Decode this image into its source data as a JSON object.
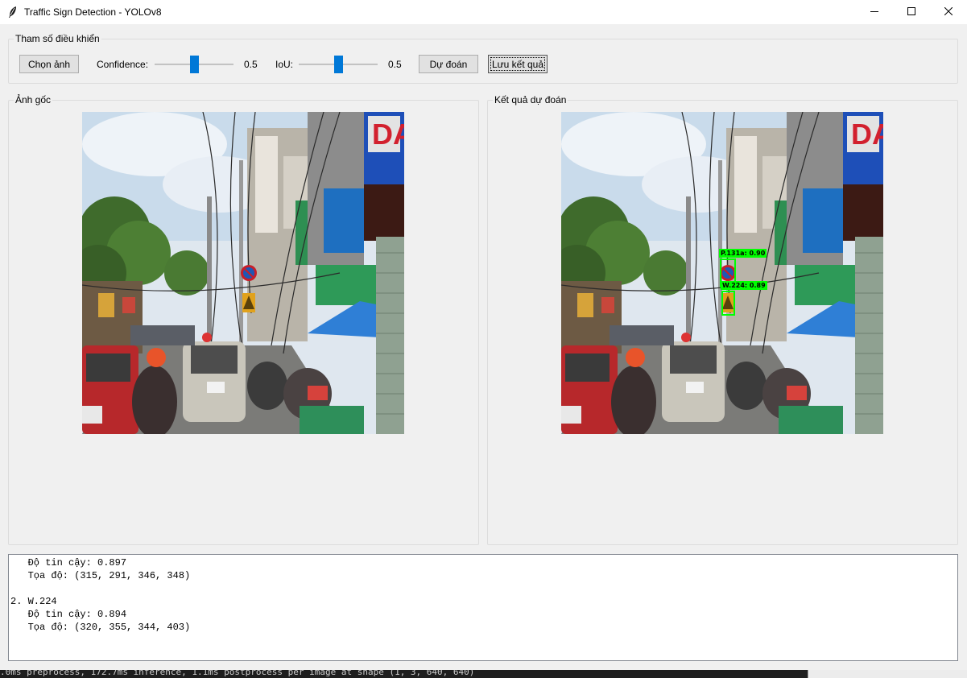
{
  "window": {
    "title": "Traffic Sign Detection - YOLOv8"
  },
  "controls": {
    "group_label": "Tham số điều khiển",
    "choose_image": "Chọn ảnh",
    "confidence_label": "Confidence:",
    "confidence_value": "0.5",
    "confidence_level": 0.5,
    "iou_label": "IoU:",
    "iou_value": "0.5",
    "iou_level": 0.5,
    "predict": "Dự đoán",
    "save_result": "Lưu kết quả"
  },
  "original": {
    "group_label": "Ảnh gốc"
  },
  "result": {
    "group_label": "Kết quả dự đoán",
    "detections": [
      {
        "label": "P.131a: 0.90"
      },
      {
        "label": "W.224: 0.89"
      }
    ]
  },
  "output": {
    "lines": [
      "   Độ tin cậy: 0.897",
      "   Tọa độ: (315, 291, 346, 348)",
      "",
      "2. W.224",
      "   Độ tin cậy: 0.894",
      "   Tọa độ: (320, 355, 344, 403)"
    ]
  },
  "console": {
    "text": ".0ms preprocess, 172.7ms inference, 1.1ms postprocess per image at shape (1, 3, 640, 640)"
  }
}
